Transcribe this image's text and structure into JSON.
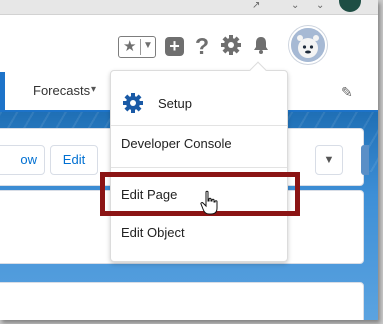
{
  "header": {
    "favorites_icon": "star-icon",
    "add_icon": "plus-icon",
    "help_icon": "question-icon",
    "setup_icon": "gear-icon",
    "notifications_icon": "bell-icon",
    "avatar_icon": "astro-avatar"
  },
  "tabs": {
    "forecasts_label": "Forecasts"
  },
  "actions": {
    "follow_fragment": "ow",
    "edit_label": "Edit"
  },
  "setup_menu": {
    "items": [
      {
        "label": "Setup"
      },
      {
        "label": "Developer Console"
      },
      {
        "label": "Edit Page"
      },
      {
        "label": "Edit Object"
      }
    ]
  },
  "colors": {
    "highlight_box": "#8b1414",
    "brand_blue": "#1d73c9",
    "link_blue": "#0070d2"
  }
}
